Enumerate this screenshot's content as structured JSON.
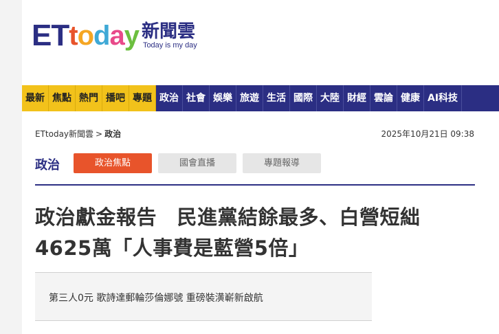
{
  "logo": {
    "et": "ET",
    "today_letters": [
      "t",
      "o",
      "d",
      "a",
      "y"
    ],
    "cn_name": "新聞雲",
    "slogan": "Today is my day"
  },
  "nav": [
    {
      "label": "最新",
      "style": "yellow"
    },
    {
      "label": "焦點",
      "style": "yellow"
    },
    {
      "label": "熱門",
      "style": "yellow"
    },
    {
      "label": "播吧",
      "style": "yellow"
    },
    {
      "label": "專題",
      "style": "yellow"
    },
    {
      "label": "政治",
      "style": "blue"
    },
    {
      "label": "社會",
      "style": "blue"
    },
    {
      "label": "娛樂",
      "style": "blue"
    },
    {
      "label": "旅遊",
      "style": "blue"
    },
    {
      "label": "生活",
      "style": "blue"
    },
    {
      "label": "國際",
      "style": "blue"
    },
    {
      "label": "大陸",
      "style": "blue"
    },
    {
      "label": "財經",
      "style": "blue"
    },
    {
      "label": "雲論",
      "style": "blue"
    },
    {
      "label": "健康",
      "style": "blue"
    },
    {
      "label": "AI科技",
      "style": "blue"
    }
  ],
  "breadcrumb": {
    "home": "ETtoday新聞雲",
    "separator": ">",
    "current": "政治"
  },
  "date": "2025年10月21日 09:38",
  "section": {
    "title": "政治",
    "tabs": [
      "政治焦點",
      "國會直播",
      "專題報導"
    ]
  },
  "article": {
    "headline_line1": "政治獻金報告　民進黨結餘最多、白營短絀",
    "headline_line2": "4625萬「人事費是藍營5倍」"
  },
  "related": {
    "text": "第三人0元 歌詩達郵輪莎倫娜號 重磅裝潢嶄新啟航"
  },
  "colors": {
    "brand_navy": "#2b2e83",
    "nav_yellow": "#f2c21b",
    "active_tab": "#e8542b"
  }
}
